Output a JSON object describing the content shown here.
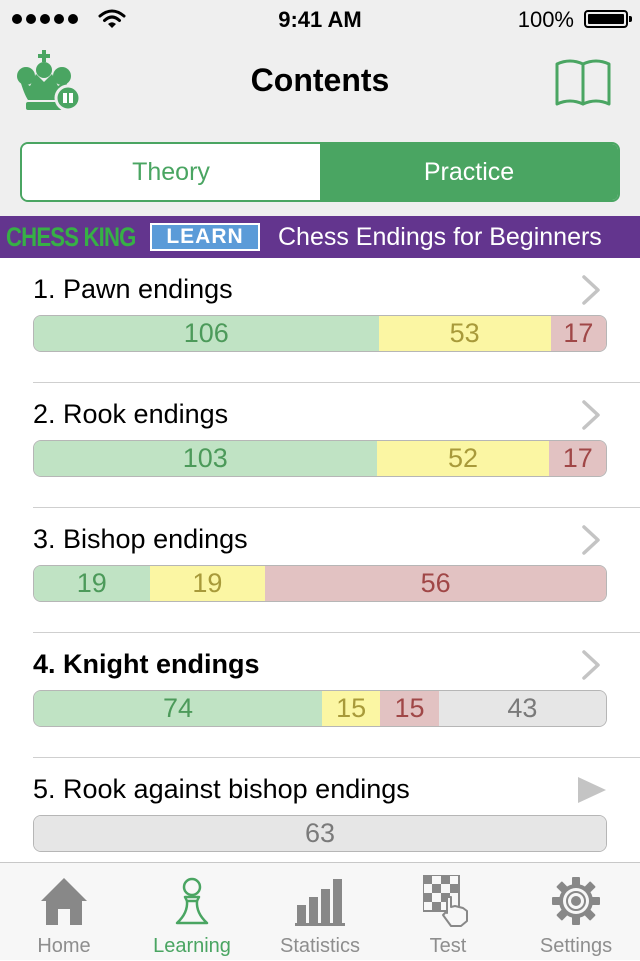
{
  "status_bar": {
    "time": "9:41 AM",
    "battery": "100%"
  },
  "nav": {
    "title": "Contents"
  },
  "segmented": {
    "theory": "Theory",
    "practice": "Practice",
    "selected": "Practice"
  },
  "banner": {
    "brand": "CHESS KING",
    "badge": "LEARN",
    "title": "Chess Endings for Beginners"
  },
  "chapters": [
    {
      "title": "1. Pawn endings",
      "bold": false,
      "arrow": "chevron-right-icon",
      "bar": [
        {
          "value": "106",
          "status": "correct"
        },
        {
          "value": "53",
          "status": "partial"
        },
        {
          "value": "17",
          "status": "wrong"
        }
      ]
    },
    {
      "title": "2. Rook endings",
      "bold": false,
      "arrow": "chevron-right-icon",
      "bar": [
        {
          "value": "103",
          "status": "correct"
        },
        {
          "value": "52",
          "status": "partial"
        },
        {
          "value": "17",
          "status": "wrong"
        }
      ]
    },
    {
      "title": "3. Bishop endings",
      "bold": false,
      "arrow": "chevron-right-icon",
      "bar": [
        {
          "value": "19",
          "status": "correct"
        },
        {
          "value": "19",
          "status": "partial"
        },
        {
          "value": "56",
          "status": "wrong"
        }
      ]
    },
    {
      "title": "4. Knight endings",
      "bold": true,
      "arrow": "chevron-right-icon",
      "bar": [
        {
          "value": "74",
          "status": "correct"
        },
        {
          "value": "15",
          "status": "partial"
        },
        {
          "value": "15",
          "status": "wrong"
        },
        {
          "value": "43",
          "status": "unsolved"
        }
      ]
    },
    {
      "title": "5. Rook against bishop endings",
      "bold": false,
      "arrow": "play-icon",
      "bar": [
        {
          "value": "63",
          "status": "unsolved"
        }
      ]
    }
  ],
  "tabs": [
    {
      "label": "Home",
      "icon": "home-icon",
      "active": false
    },
    {
      "label": "Learning",
      "icon": "pawn-icon",
      "active": true
    },
    {
      "label": "Statistics",
      "icon": "bar-chart-icon",
      "active": false
    },
    {
      "label": "Test",
      "icon": "chessboard-hand-icon",
      "active": false
    },
    {
      "label": "Settings",
      "icon": "gear-icon",
      "active": false
    }
  ],
  "colors": {
    "accent": "#4aa562",
    "banner": "#63358e",
    "correct": "#c0e3c4",
    "partial": "#fbf6a3",
    "wrong": "#e2c2c2",
    "unsolved": "#e6e6e6"
  }
}
